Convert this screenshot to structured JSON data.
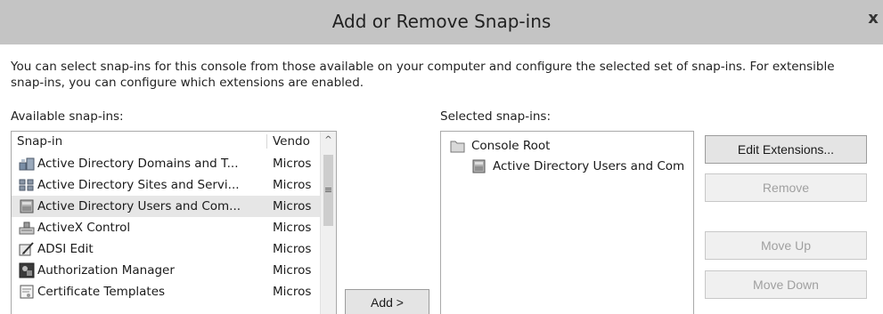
{
  "window": {
    "title": "Add or Remove Snap-ins",
    "close_glyph": "x"
  },
  "description": "You can select snap-ins for this console from those available on your computer and configure the selected set of snap-ins. For extensible snap-ins, you can configure which extensions are enabled.",
  "available": {
    "label": "Available snap-ins:",
    "columns": [
      "Snap-in",
      "Vendo"
    ],
    "scroll_up_glyph": "^",
    "scroll_grip_glyph": "≡",
    "items": [
      {
        "name": "Active Directory Domains and T...",
        "vendor": "Micros",
        "icon": "domains-icon"
      },
      {
        "name": "Active Directory Sites and Servi...",
        "vendor": "Micros",
        "icon": "sites-icon"
      },
      {
        "name": "Active Directory Users and Com...",
        "vendor": "Micros",
        "icon": "users-computers-icon",
        "selected": true
      },
      {
        "name": "ActiveX Control",
        "vendor": "Micros",
        "icon": "activex-icon"
      },
      {
        "name": "ADSI Edit",
        "vendor": "Micros",
        "icon": "adsi-edit-icon"
      },
      {
        "name": "Authorization Manager",
        "vendor": "Micros",
        "icon": "authorization-manager-icon"
      },
      {
        "name": "Certificate Templates",
        "vendor": "Micros",
        "icon": "certificate-templates-icon"
      }
    ]
  },
  "add_button": "Add >",
  "selected": {
    "label": "Selected snap-ins:",
    "items": [
      {
        "name": "Console Root",
        "icon": "folder-icon",
        "level": 0
      },
      {
        "name": "Active Directory Users and Com",
        "icon": "users-computers-icon",
        "level": 1
      }
    ]
  },
  "buttons": {
    "edit_extensions": "Edit Extensions...",
    "remove": "Remove",
    "move_up": "Move Up",
    "move_down": "Move Down"
  },
  "colors": {
    "titlebar": "#c4c4c4",
    "selection": "#e6e6e6",
    "disabled_text": "#a0a0a0"
  }
}
